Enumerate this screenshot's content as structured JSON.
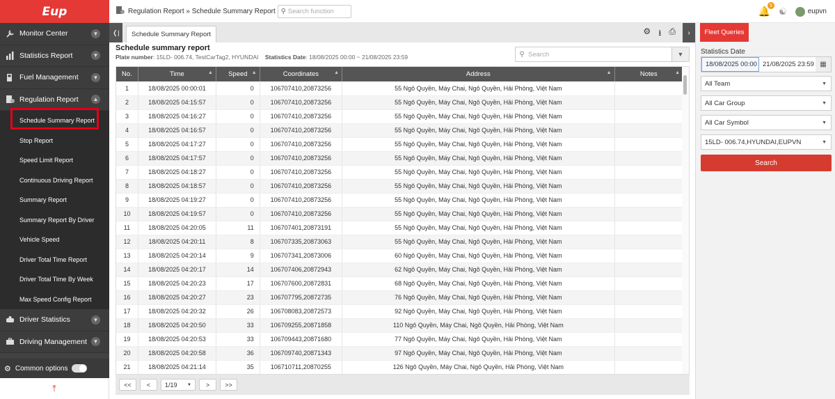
{
  "logo": "Eup",
  "sidebar": {
    "items": [
      {
        "label": "Monitor Center",
        "icon": "wrench-icon"
      },
      {
        "label": "Statistics Report",
        "icon": "bar-chart-icon"
      },
      {
        "label": "Fuel Management",
        "icon": "fuel-icon"
      },
      {
        "label": "Regulation Report",
        "icon": "document-icon"
      }
    ],
    "sub_items": [
      "Schedule Summary Report",
      "Stop Report",
      "Speed Limit Report",
      "Continuous Driving Report",
      "Summary Report",
      "Summary Report By Driver",
      "Vehicle Speed",
      "Driver Total Time Report",
      "Driver Total Time By Week",
      "Max Speed Config Report"
    ],
    "items2": [
      {
        "label": "Driver Statistics",
        "icon": "driver-icon"
      },
      {
        "label": "Driving Management",
        "icon": "briefcase-icon"
      }
    ],
    "common_options": "Common options"
  },
  "header": {
    "breadcrumb": "Regulation Report » Schedule Summary Report",
    "search_placeholder": "Search function",
    "notif_count": "5",
    "user": "eupvn"
  },
  "tab": {
    "label": "Schedule Summary Report"
  },
  "report": {
    "title": "Schedule summary report",
    "plate_label": "Plate number",
    "plate_value": ": 15LD- 006.74, TestCarTag2, HYUNDAI",
    "stat_label": "Statistics Date",
    "stat_value": ": 18/08/2025 00:00 ~ 21/08/2025 23:59",
    "search_placeholder": "Search"
  },
  "table": {
    "columns": [
      "No.",
      "Time",
      "Speed",
      "Coordinates",
      "Address",
      "Notes"
    ],
    "rows": [
      [
        "1",
        "18/08/2025 00:00:01",
        "0",
        "106707410,20873256",
        "55 Ngô Quyền, Máy Chai, Ngô Quyền, Hải Phòng, Việt Nam",
        ""
      ],
      [
        "2",
        "18/08/2025 04:15:57",
        "0",
        "106707410,20873256",
        "55 Ngô Quyền, Máy Chai, Ngô Quyền, Hải Phòng, Việt Nam",
        ""
      ],
      [
        "3",
        "18/08/2025 04:16:27",
        "0",
        "106707410,20873256",
        "55 Ngô Quyền, Máy Chai, Ngô Quyền, Hải Phòng, Việt Nam",
        ""
      ],
      [
        "4",
        "18/08/2025 04:16:57",
        "0",
        "106707410,20873256",
        "55 Ngô Quyền, Máy Chai, Ngô Quyền, Hải Phòng, Việt Nam",
        ""
      ],
      [
        "5",
        "18/08/2025 04:17:27",
        "0",
        "106707410,20873256",
        "55 Ngô Quyền, Máy Chai, Ngô Quyền, Hải Phòng, Việt Nam",
        ""
      ],
      [
        "6",
        "18/08/2025 04:17:57",
        "0",
        "106707410,20873256",
        "55 Ngô Quyền, Máy Chai, Ngô Quyền, Hải Phòng, Việt Nam",
        ""
      ],
      [
        "7",
        "18/08/2025 04:18:27",
        "0",
        "106707410,20873256",
        "55 Ngô Quyền, Máy Chai, Ngô Quyền, Hải Phòng, Việt Nam",
        ""
      ],
      [
        "8",
        "18/08/2025 04:18:57",
        "0",
        "106707410,20873256",
        "55 Ngô Quyền, Máy Chai, Ngô Quyền, Hải Phòng, Việt Nam",
        ""
      ],
      [
        "9",
        "18/08/2025 04:19:27",
        "0",
        "106707410,20873256",
        "55 Ngô Quyền, Máy Chai, Ngô Quyền, Hải Phòng, Việt Nam",
        ""
      ],
      [
        "10",
        "18/08/2025 04:19:57",
        "0",
        "106707410,20873256",
        "55 Ngô Quyền, Máy Chai, Ngô Quyền, Hải Phòng, Việt Nam",
        ""
      ],
      [
        "11",
        "18/08/2025 04:20:05",
        "11",
        "106707401,20873191",
        "55 Ngô Quyền, Máy Chai, Ngô Quyền, Hải Phòng, Việt Nam",
        ""
      ],
      [
        "12",
        "18/08/2025 04:20:11",
        "8",
        "106707335,20873063",
        "55 Ngô Quyền, Máy Chai, Ngô Quyền, Hải Phòng, Việt Nam",
        ""
      ],
      [
        "13",
        "18/08/2025 04:20:14",
        "9",
        "106707341,20873006",
        "60 Ngô Quyền, Máy Chai, Ngô Quyền, Hải Phòng, Việt Nam",
        ""
      ],
      [
        "14",
        "18/08/2025 04:20:17",
        "14",
        "106707406,20872943",
        "62 Ngô Quyền, Máy Chai, Ngô Quyền, Hải Phòng, Việt Nam",
        ""
      ],
      [
        "15",
        "18/08/2025 04:20:23",
        "17",
        "106707600,20872831",
        "68 Ngô Quyền, Máy Chai, Ngô Quyền, Hải Phòng, Việt Nam",
        ""
      ],
      [
        "16",
        "18/08/2025 04:20:27",
        "23",
        "106707795,20872735",
        "76 Ngô Quyền, Máy Chai, Ngô Quyền, Hải Phòng, Việt Nam",
        ""
      ],
      [
        "17",
        "18/08/2025 04:20:32",
        "26",
        "106708083,20872573",
        "92 Ngô Quyền, Máy Chai, Ngô Quyền, Hải Phòng, Việt Nam",
        ""
      ],
      [
        "18",
        "18/08/2025 04:20:50",
        "33",
        "106709255,20871858",
        "110 Ngô Quyền, Máy Chai, Ngô Quyền, Hải Phòng, Việt Nam",
        ""
      ],
      [
        "19",
        "18/08/2025 04:20:53",
        "33",
        "106709443,20871680",
        "77 Ngô Quyền, Máy Chai, Ngô Quyền, Hải Phòng, Việt Nam",
        ""
      ],
      [
        "20",
        "18/08/2025 04:20:58",
        "36",
        "106709740,20871343",
        "97 Ngô Quyền, Máy Chai, Ngô Quyền, Hải Phòng, Việt Nam",
        ""
      ],
      [
        "21",
        "18/08/2025 04:21:14",
        "35",
        "106710711,20870255",
        "126 Ngô Quyền, Máy Chai, Ngô Quyền, Hải Phòng, Việt Nam",
        ""
      ]
    ]
  },
  "pager": {
    "first": "<<",
    "prev": "<",
    "page": "1/19",
    "next": ">",
    "last": ">>"
  },
  "right_panel": {
    "tab": "Fleet Queries",
    "stat_label": "Statistics Date",
    "date_from": "18/08/2025 00:00",
    "date_to": "21/08/2025 23:59",
    "team": "All Team",
    "car_group": "All Car Group",
    "car_symbol": "All Car Symbol",
    "vehicle": "15LD- 006.74,HYUNDAI,EUPVN",
    "search_btn": "Search"
  }
}
